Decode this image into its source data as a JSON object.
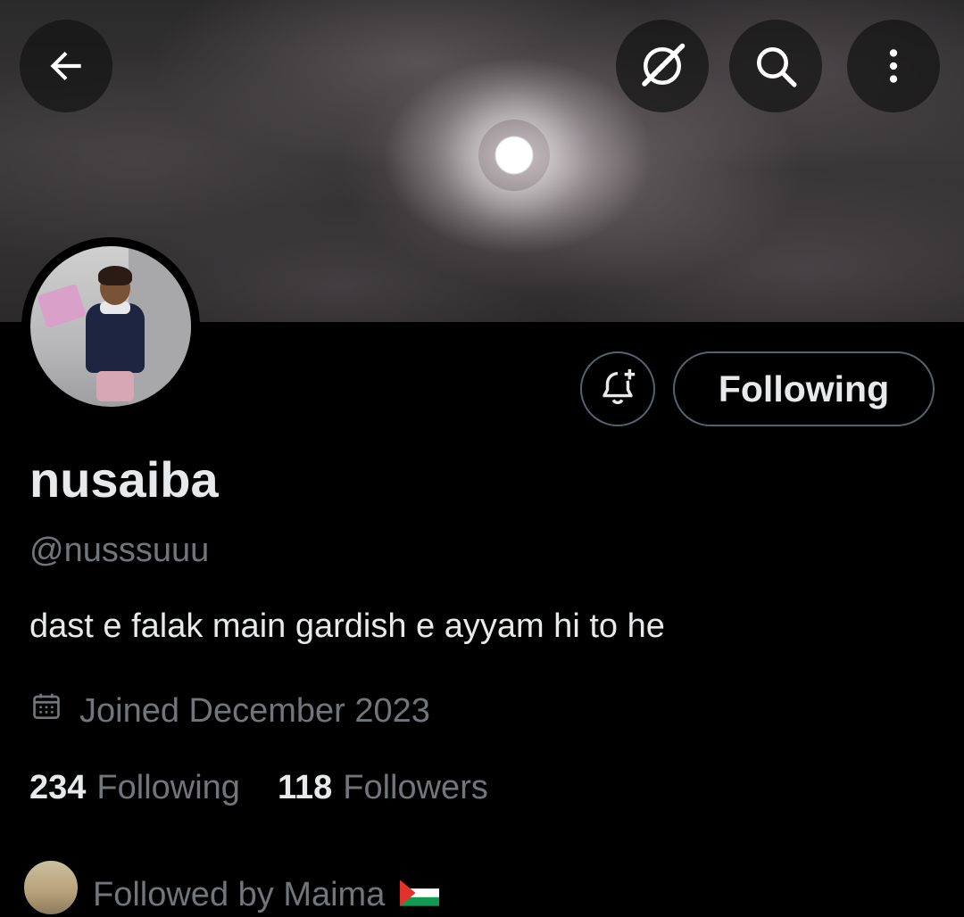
{
  "header": {
    "back_icon": "arrow-left-icon",
    "grok_icon": "grok-icon",
    "search_icon": "search-icon",
    "more_icon": "more-vertical-icon"
  },
  "profile": {
    "display_name": "nusaiba",
    "handle": "@nusssuuu",
    "bio": "dast e falak main gardish e ayyam hi to he",
    "joined": "Joined December 2023",
    "following_count": "234",
    "following_label": "Following",
    "followers_count": "118",
    "followers_label": "Followers"
  },
  "actions": {
    "notify_icon": "bell-plus-icon",
    "follow_state_label": "Following"
  },
  "followed_by": {
    "text": "Followed by Maima",
    "flag_icon": "palestine-flag-icon"
  },
  "colors": {
    "background": "#000000",
    "primary_text": "#e7e9ea",
    "secondary_text": "#71767b",
    "button_border": "#536471"
  }
}
